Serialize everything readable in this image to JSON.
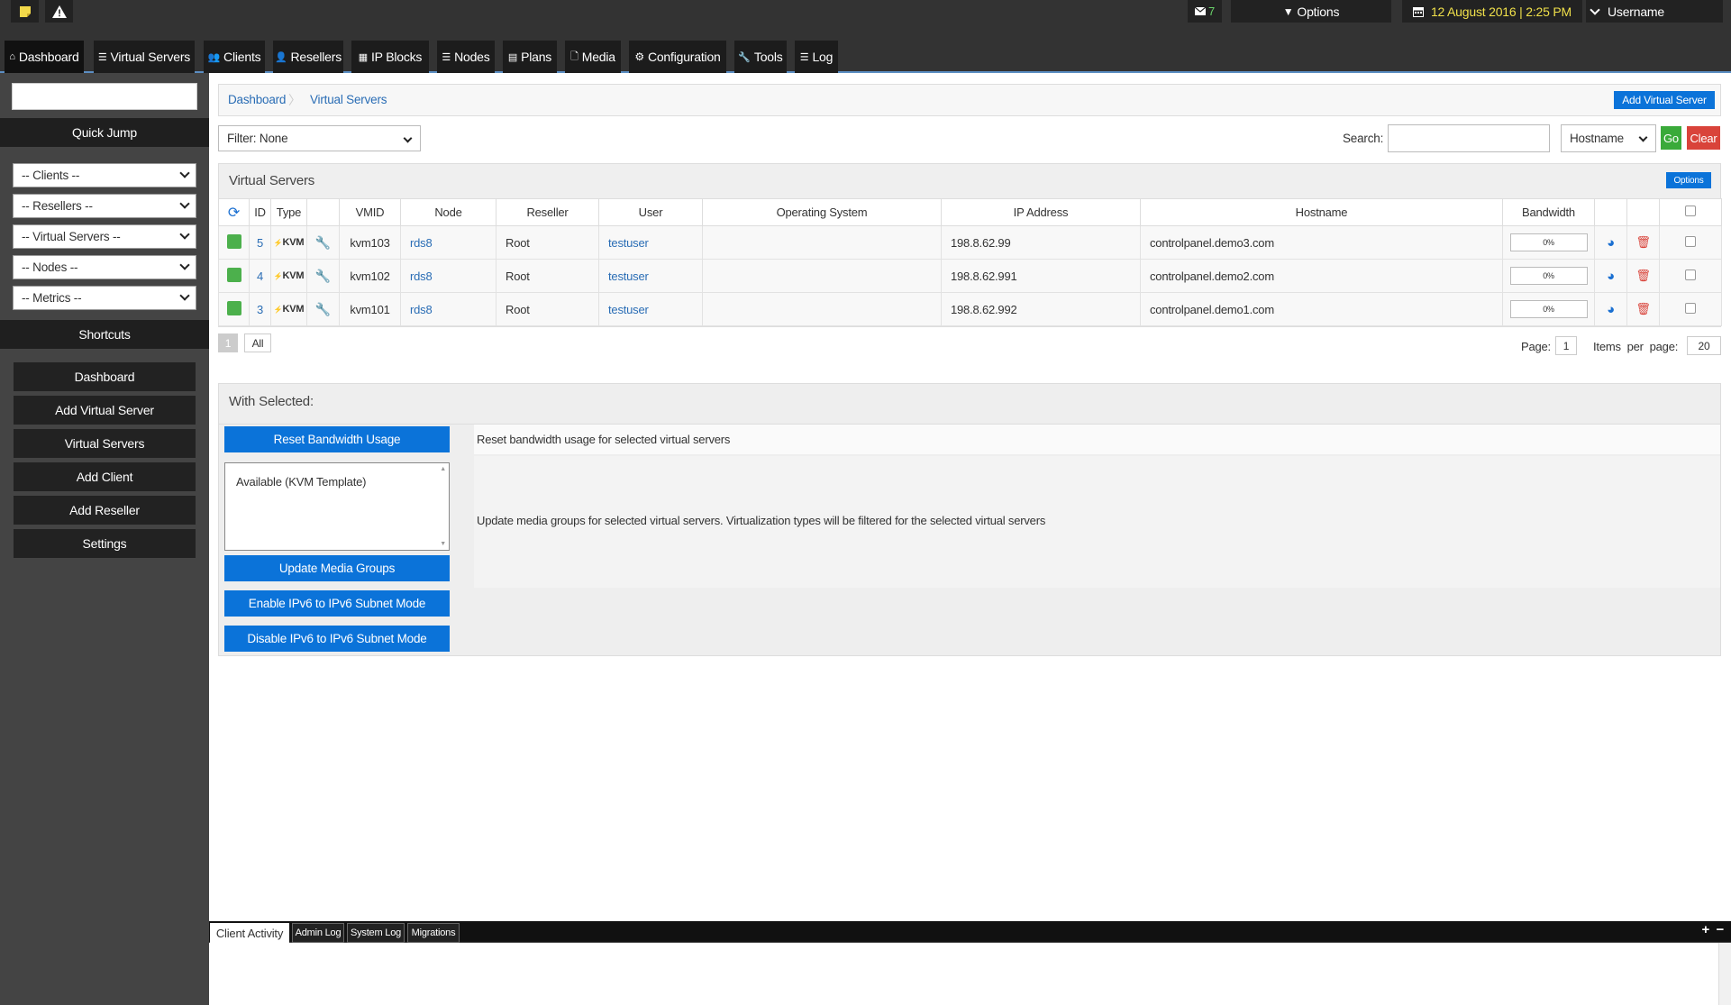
{
  "topbar": {
    "mail_count": "7",
    "options_label": "Options",
    "datetime": "12 August 2016 | 2:25 PM",
    "username": "Username",
    "colors": {
      "datetime": "#f0e04a",
      "mail": "#6ad36a",
      "note": "#f3d94a"
    }
  },
  "nav": [
    {
      "icon": "home-icon",
      "label": "Dashboard"
    },
    {
      "icon": "list-icon",
      "label": "Virtual Servers"
    },
    {
      "icon": "users-icon",
      "label": "Clients"
    },
    {
      "icon": "user-icon",
      "label": "Resellers"
    },
    {
      "icon": "grid-icon",
      "label": "IP Blocks"
    },
    {
      "icon": "list-icon",
      "label": "Nodes"
    },
    {
      "icon": "table-icon",
      "label": "Plans"
    },
    {
      "icon": "file-icon",
      "label": "Media"
    },
    {
      "icon": "gear-icon",
      "label": "Configuration"
    },
    {
      "icon": "wrench-icon",
      "label": "Tools"
    },
    {
      "icon": "list-icon",
      "label": "Log"
    }
  ],
  "sidebar": {
    "quick_jump": "Quick Jump",
    "selects": [
      "-- Clients --",
      "-- Resellers --",
      "-- Virtual Servers --",
      "-- Nodes --",
      "-- Metrics --"
    ],
    "shortcuts_title": "Shortcuts",
    "shortcuts": [
      "Dashboard",
      "Add Virtual Server",
      "Virtual Servers",
      "Add Client",
      "Add Reseller",
      "Settings"
    ]
  },
  "breadcrumb": {
    "items": [
      "Dashboard",
      "Virtual Servers"
    ],
    "add_button": "Add Virtual Server"
  },
  "filter": {
    "value": "Filter: None",
    "search_label": "Search:",
    "search_value": "",
    "search_by": "Hostname",
    "go": "Go",
    "clear": "Clear"
  },
  "panel": {
    "title": "Virtual Servers",
    "options": "Options"
  },
  "table": {
    "headers": [
      "ID",
      "Type",
      "VMID",
      "Node",
      "Reseller",
      "User",
      "Operating System",
      "IP Address",
      "Hostname",
      "Bandwidth"
    ],
    "rows": [
      {
        "id": "5",
        "type": "KVM",
        "vmid": "kvm103",
        "node": "rds8",
        "reseller": "Root",
        "user": "testuser",
        "os": "",
        "ip": "198.8.62.99",
        "hostname": "controlpanel.demo3.com",
        "bandwidth": "0%"
      },
      {
        "id": "4",
        "type": "KVM",
        "vmid": "kvm102",
        "node": "rds8",
        "reseller": "Root",
        "user": "testuser",
        "os": "",
        "ip": "198.8.62.991",
        "hostname": "controlpanel.demo2.com",
        "bandwidth": "0%"
      },
      {
        "id": "3",
        "type": "KVM",
        "vmid": "kvm101",
        "node": "rds8",
        "reseller": "Root",
        "user": "testuser",
        "os": "",
        "ip": "198.8.62.992",
        "hostname": "controlpanel.demo1.com",
        "bandwidth": "0%"
      }
    ],
    "status_color": "#4cb04c"
  },
  "pager": {
    "current": "1",
    "all": "All",
    "page_label": "Page:",
    "page_value": "1",
    "items_label": "Items  per  page:",
    "items_value": "20"
  },
  "with_selected": {
    "title": "With Selected:",
    "reset_bw": "Reset Bandwidth Usage",
    "reset_bw_desc": "Reset bandwidth usage for selected virtual servers",
    "media_option": "Available (KVM Template)",
    "update_media": "Update Media Groups",
    "update_media_desc": "Update media groups for selected virtual servers. Virtualization types will be filtered for the selected virtual servers",
    "enable_ipv6": "Enable IPv6 to IPv6 Subnet Mode",
    "disable_ipv6": "Disable IPv6 to IPv6 Subnet Mode"
  },
  "log_tabs": [
    "Client Activity",
    "Admin Log",
    "System Log",
    "Migrations"
  ],
  "log_controls": {
    "expand": "+",
    "collapse": "−"
  }
}
